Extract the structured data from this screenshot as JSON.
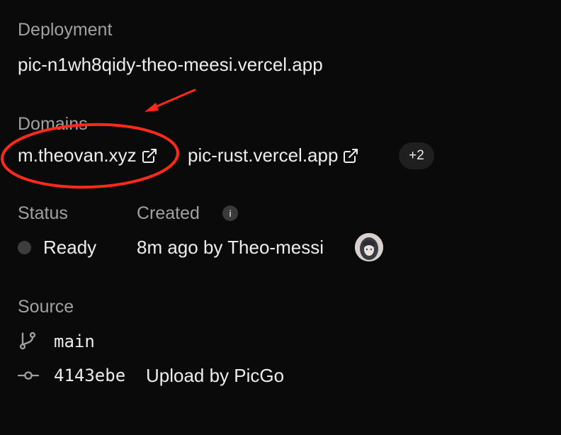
{
  "deployment": {
    "label": "Deployment",
    "url": "pic-n1wh8qidy-theo-meesi.vercel.app"
  },
  "domains": {
    "label": "Domains",
    "items": [
      {
        "text": "m.theovan.xyz",
        "icon": "external-link-icon"
      },
      {
        "text": "pic-rust.vercel.app",
        "icon": "external-link-icon"
      }
    ],
    "more_count": "+2"
  },
  "status": {
    "label": "Status",
    "value": "Ready",
    "icon": "status-dot"
  },
  "created": {
    "label": "Created",
    "value": "8m ago by Theo-messi",
    "icon": "info-icon",
    "avatar": "user-avatar"
  },
  "source": {
    "label": "Source",
    "branch": {
      "name": "main",
      "icon": "git-branch-icon"
    },
    "commit": {
      "hash": "4143ebe",
      "message": "Upload by PicGo",
      "icon": "git-commit-icon"
    }
  },
  "colors": {
    "background": "#0a0a0a",
    "text": "#ededed",
    "muted": "#a1a1a1",
    "annotation": "#ff2a1a"
  }
}
